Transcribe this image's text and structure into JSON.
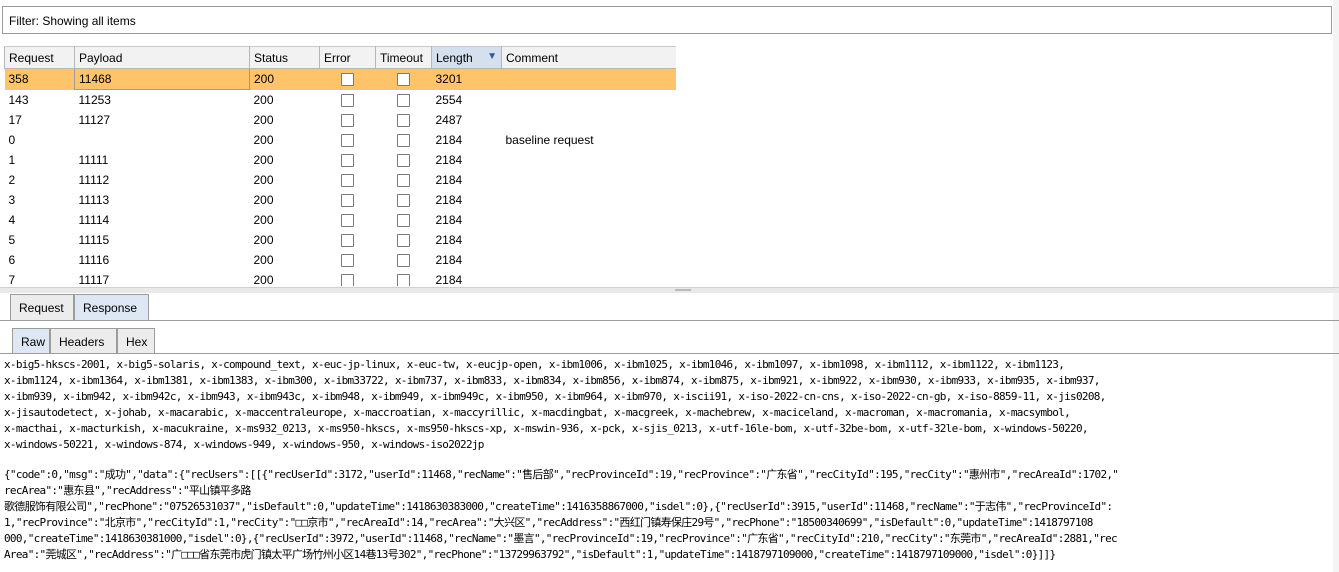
{
  "filter": {
    "text": "Filter: Showing all items"
  },
  "table": {
    "columns": [
      "Request",
      "Payload",
      "Status",
      "Error",
      "Timeout",
      "Length",
      "Comment"
    ],
    "sort_indicator": "▼",
    "rows": [
      {
        "request": "358",
        "payload": "11468",
        "status": "200",
        "length": "3201",
        "comment": ""
      },
      {
        "request": "143",
        "payload": "11253",
        "status": "200",
        "length": "2554",
        "comment": ""
      },
      {
        "request": "17",
        "payload": "11127",
        "status": "200",
        "length": "2487",
        "comment": ""
      },
      {
        "request": "0",
        "payload": "",
        "status": "200",
        "length": "2184",
        "comment": "baseline request"
      },
      {
        "request": "1",
        "payload": "11111",
        "status": "200",
        "length": "2184",
        "comment": ""
      },
      {
        "request": "2",
        "payload": "11112",
        "status": "200",
        "length": "2184",
        "comment": ""
      },
      {
        "request": "3",
        "payload": "11113",
        "status": "200",
        "length": "2184",
        "comment": ""
      },
      {
        "request": "4",
        "payload": "11114",
        "status": "200",
        "length": "2184",
        "comment": ""
      },
      {
        "request": "5",
        "payload": "11115",
        "status": "200",
        "length": "2184",
        "comment": ""
      },
      {
        "request": "6",
        "payload": "11116",
        "status": "200",
        "length": "2184",
        "comment": ""
      },
      {
        "request": "7",
        "payload": "11117",
        "status": "200",
        "length": "2184",
        "comment": ""
      }
    ]
  },
  "tabs": {
    "request": "Request",
    "response": "Response"
  },
  "subtabs": {
    "raw": "Raw",
    "headers": "Headers",
    "hex": "Hex"
  },
  "response": {
    "charset_lines": [
      "x-big5-hkscs-2001, x-big5-solaris, x-compound_text, x-euc-jp-linux, x-euc-tw, x-eucjp-open, x-ibm1006, x-ibm1025, x-ibm1046, x-ibm1097, x-ibm1098, x-ibm1112, x-ibm1122, x-ibm1123,",
      "x-ibm1124, x-ibm1364, x-ibm1381, x-ibm1383, x-ibm300, x-ibm33722, x-ibm737, x-ibm833, x-ibm834, x-ibm856, x-ibm874, x-ibm875, x-ibm921, x-ibm922, x-ibm930, x-ibm933, x-ibm935, x-ibm937,",
      "x-ibm939, x-ibm942, x-ibm942c, x-ibm943, x-ibm943c, x-ibm948, x-ibm949, x-ibm949c, x-ibm950, x-ibm964, x-ibm970, x-iscii91, x-iso-2022-cn-cns, x-iso-2022-cn-gb, x-iso-8859-11, x-jis0208,",
      "x-jisautodetect, x-johab, x-macarabic, x-maccentraleurope, x-maccroatian, x-maccyrillic, x-macdingbat, x-macgreek, x-machebrew, x-maciceland, x-macroman, x-macromania, x-macsymbol,",
      "x-macthai, x-macturkish, x-macukraine, x-ms932_0213, x-ms950-hkscs, x-ms950-hkscs-xp, x-mswin-936, x-pck, x-sjis_0213, x-utf-16le-bom, x-utf-32be-bom, x-utf-32le-bom, x-windows-50220,",
      "x-windows-50221, x-windows-874, x-windows-949, x-windows-950, x-windows-iso2022jp"
    ],
    "json_lines": [
      "{\"code\":0,\"msg\":\"成功\",\"data\":{\"recUsers\":[[{\"recUserId\":3172,\"userId\":11468,\"recName\":\"售后部\",\"recProvinceId\":19,\"recProvince\":\"广东省\",\"recCityId\":195,\"recCity\":\"惠州市\",\"recAreaId\":1702,\"",
      "recArea\":\"惠东县\",\"recAddress\":\"平山镇平多路",
      "歌德服饰有限公司\",\"recPhone\":\"07526531037\",\"isDefault\":0,\"updateTime\":1418630383000,\"createTime\":1416358867000,\"isdel\":0},{\"recUserId\":3915,\"userId\":11468,\"recName\":\"于志伟\",\"recProvinceId\":",
      "1,\"recProvince\":\"北京市\",\"recCityId\":1,\"recCity\":\"□□京市\",\"recAreaId\":14,\"recArea\":\"大兴区\",\"recAddress\":\"西红门镇寿保庄29号\",\"recPhone\":\"18500340699\",\"isDefault\":0,\"updateTime\":1418797108",
      "000,\"createTime\":1418630381000,\"isdel\":0},{\"recUserId\":3972,\"userId\":11468,\"recName\":\"墨言\",\"recProvinceId\":19,\"recProvince\":\"广东省\",\"recCityId\":210,\"recCity\":\"东莞市\",\"recAreaId\":2881,\"rec",
      "Area\":\"莞城区\",\"recAddress\":\"广□□□省东莞市虎门镇太平广场竹州小区14巷13号302\",\"recPhone\":\"13729963792\",\"isDefault\":1,\"updateTime\":1418797109000,\"createTime\":1418797109000,\"isdel\":0}]]}"
    ]
  },
  "colors": {
    "selected_row": "#ffc46a",
    "active_tab": "#dde8f4",
    "sorted_header": "#d4e0ee"
  }
}
